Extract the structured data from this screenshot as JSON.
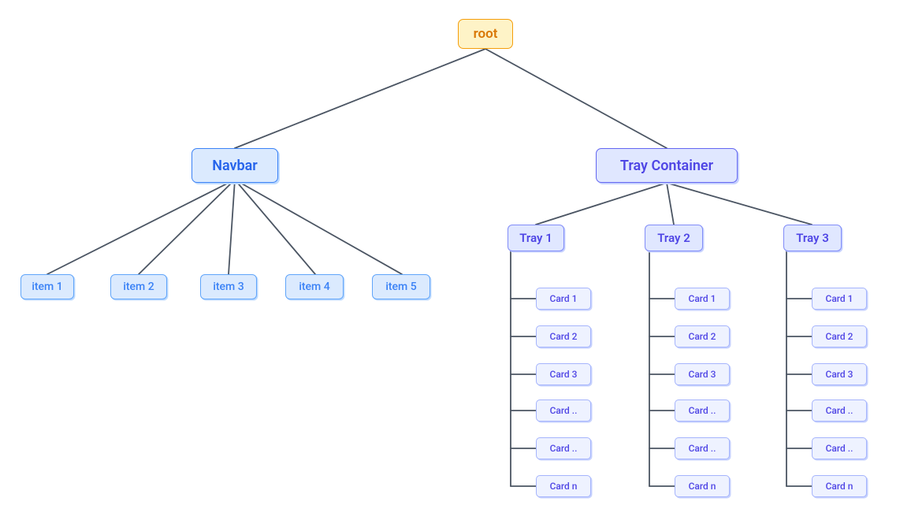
{
  "nodes": {
    "root": "root",
    "navbar": "Navbar",
    "trayContainer": "Tray Container",
    "navItems": [
      "item 1",
      "item 2",
      "item 3",
      "item 4",
      "item 5"
    ],
    "trayHeaders": [
      "Tray 1",
      "Tray 2",
      "Tray 3"
    ],
    "cards": [
      "Card 1",
      "Card 2",
      "Card 3",
      "Card ..",
      "Card ..",
      "Card n"
    ]
  },
  "colors": {
    "rootBg": "#FEF3C7",
    "rootBorder": "#F59E0B",
    "rootText": "#D97706",
    "navBg": "#DBEAFE",
    "navBorder": "#3B82F6",
    "navText": "#2563EB",
    "navShadow": "#BFDBFE",
    "trayBg": "#E0E7FF",
    "trayBorder": "#6366F1",
    "trayText": "#4F46E5",
    "trayShadow": "#C7D2FE",
    "itemBg": "#DBEAFE",
    "itemBorder": "#60A5FA",
    "itemText": "#3B82F6",
    "cardBg": "#EEF2FF",
    "cardBorder": "#A5B4FC",
    "cardText": "#4F46E5",
    "edge": "#4B5563"
  },
  "chart_data": {
    "type": "tree",
    "root": {
      "label": "root",
      "children": [
        {
          "label": "Navbar",
          "children": [
            {
              "label": "item 1"
            },
            {
              "label": "item 2"
            },
            {
              "label": "item 3"
            },
            {
              "label": "item 4"
            },
            {
              "label": "item 5"
            }
          ]
        },
        {
          "label": "Tray Container",
          "children": [
            {
              "label": "Tray 1",
              "children": [
                {
                  "label": "Card 1"
                },
                {
                  "label": "Card 2"
                },
                {
                  "label": "Card 3"
                },
                {
                  "label": "Card .."
                },
                {
                  "label": "Card .."
                },
                {
                  "label": "Card n"
                }
              ]
            },
            {
              "label": "Tray 2",
              "children": [
                {
                  "label": "Card 1"
                },
                {
                  "label": "Card 2"
                },
                {
                  "label": "Card 3"
                },
                {
                  "label": "Card .."
                },
                {
                  "label": "Card .."
                },
                {
                  "label": "Card n"
                }
              ]
            },
            {
              "label": "Tray 3",
              "children": [
                {
                  "label": "Card 1"
                },
                {
                  "label": "Card 2"
                },
                {
                  "label": "Card 3"
                },
                {
                  "label": "Card .."
                },
                {
                  "label": "Card .."
                },
                {
                  "label": "Card n"
                }
              ]
            }
          ]
        }
      ]
    }
  }
}
